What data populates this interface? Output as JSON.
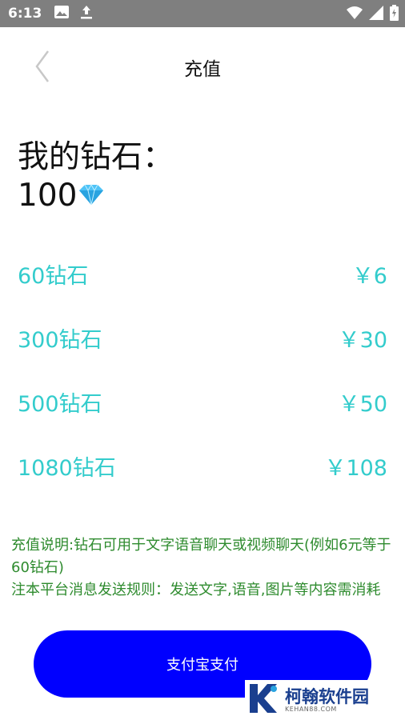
{
  "status_bar": {
    "time": "6:13",
    "icons_left": [
      "image-icon",
      "upload-icon"
    ],
    "icons_right": [
      "wifi-icon",
      "signal-icon",
      "battery-charging-icon"
    ]
  },
  "header": {
    "title": "充值",
    "back_icon": "chevron-left-icon"
  },
  "balance": {
    "label": "我的钻石：",
    "value": "100",
    "icon": "diamond-icon"
  },
  "packages": [
    {
      "name": "60钻石",
      "price": "￥6"
    },
    {
      "name": "300钻石",
      "price": "￥30"
    },
    {
      "name": "500钻石",
      "price": "￥50"
    },
    {
      "name": "1080钻石",
      "price": "￥108"
    }
  ],
  "notes": {
    "line1": "充值说明:钻石可用于文字语音聊天或视频聊天(例如6元等于60钻石)",
    "line2": "注本平台消息发送规则：发送文字,语音,图片等内容需消耗"
  },
  "pay_button": {
    "label": "支付宝支付"
  },
  "watermark": {
    "name": "柯翰软件园",
    "domain": "KEHAN88.COM"
  },
  "colors": {
    "accent": "#33cccc",
    "button": "#0000ff",
    "notes": "#2e8b2e",
    "status_bar": "#7f7f7f"
  }
}
